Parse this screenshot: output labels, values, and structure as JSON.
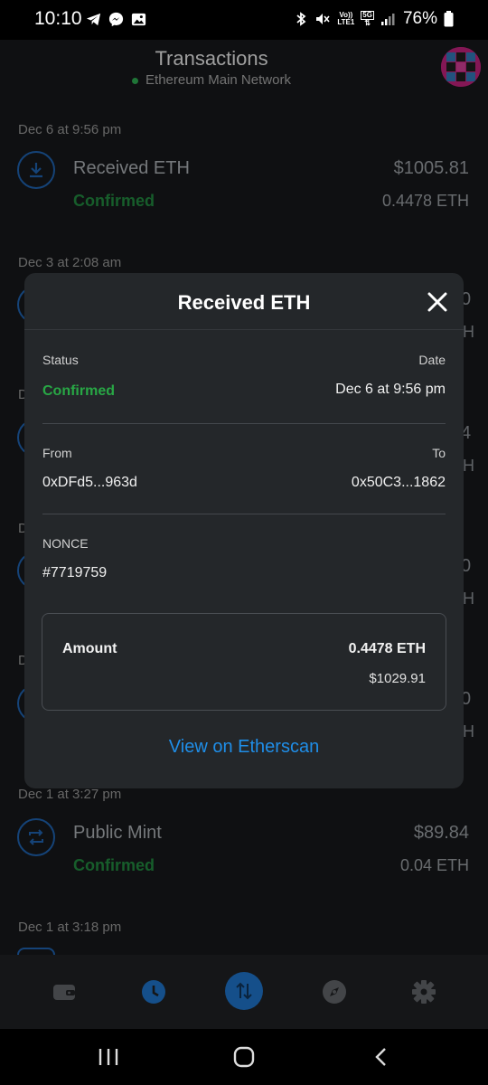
{
  "status_bar": {
    "time": "10:10",
    "volte_top": "Vo))",
    "volte_bottom": "LTE1",
    "net_5g": "5G",
    "battery": "76%"
  },
  "header": {
    "title": "Transactions",
    "network": "Ethereum Main Network"
  },
  "transactions": [
    {
      "date": "Dec 6 at 9:56 pm",
      "title": "Received ETH",
      "status": "Confirmed",
      "fiat": "$1005.81",
      "crypto": "0.4478 ETH",
      "icon": "receive-icon"
    },
    {
      "date": "Dec 3 at 2:08 am"
    },
    {
      "date": "Dec 1 at 3:27 pm",
      "title": "Public Mint",
      "status": "Confirmed",
      "fiat": "$89.84",
      "crypto": "0.04 ETH",
      "icon": "swap-icon"
    },
    {
      "date": "Dec 1 at 3:18 pm"
    }
  ],
  "peek": {
    "p1": "0",
    "p2": "H",
    "p3": "4",
    "p4": "H",
    "p5": "0",
    "p6": "H",
    "p7": "0",
    "p8": "H",
    "d1": "D",
    "d2": "D",
    "d3": "D"
  },
  "modal": {
    "title": "Received ETH",
    "status_label": "Status",
    "status_value": "Confirmed",
    "date_label": "Date",
    "date_value": "Dec 6 at 9:56 pm",
    "from_label": "From",
    "from_value": "0xDFd5...963d",
    "to_label": "To",
    "to_value": "0x50C3...1862",
    "nonce_label": "NONCE",
    "nonce_value": "#7719759",
    "amount_label": "Amount",
    "amount_crypto": "0.4478 ETH",
    "amount_fiat": "$1029.91",
    "etherscan_link": "View on Etherscan"
  },
  "bottom_nav": [
    "wallet-icon",
    "history-icon",
    "swap-icon",
    "explore-icon",
    "settings-icon"
  ],
  "colors": {
    "accent": "#1f8ee8",
    "confirmed": "#28a745",
    "background": "#141618",
    "modal": "#24272a"
  }
}
